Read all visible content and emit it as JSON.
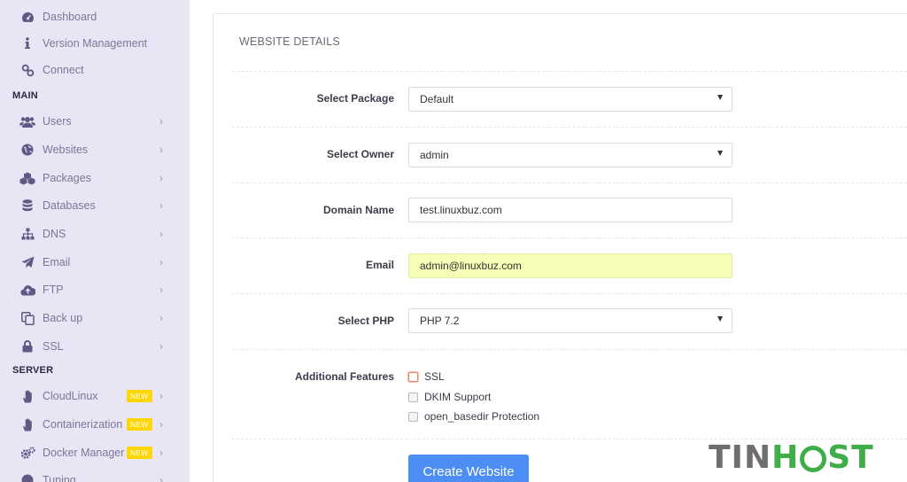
{
  "sidebar": {
    "top_items": [
      {
        "label": "Dashboard",
        "icon": "dashboard-icon"
      },
      {
        "label": "Version Management",
        "icon": "info-icon"
      },
      {
        "label": "Connect",
        "icon": "link-icon"
      }
    ],
    "main_label": "MAIN",
    "main_items": [
      {
        "label": "Users",
        "icon": "users-icon",
        "chevron": "›"
      },
      {
        "label": "Websites",
        "icon": "globe-icon",
        "chevron": "›"
      },
      {
        "label": "Packages",
        "icon": "packages-icon",
        "chevron": "›"
      },
      {
        "label": "Databases",
        "icon": "database-icon",
        "chevron": "›"
      },
      {
        "label": "DNS",
        "icon": "sitemap-icon",
        "chevron": "›"
      },
      {
        "label": "Email",
        "icon": "send-icon",
        "chevron": "›"
      },
      {
        "label": "FTP",
        "icon": "cloud-upload-icon",
        "chevron": "›"
      },
      {
        "label": "Back up",
        "icon": "copy-icon",
        "chevron": "›"
      },
      {
        "label": "SSL",
        "icon": "lock-icon",
        "chevron": "›"
      }
    ],
    "server_label": "SERVER",
    "server_items": [
      {
        "label": "CloudLinux",
        "icon": "hand-icon",
        "badge": "NEW",
        "chevron": "›"
      },
      {
        "label": "Containerization",
        "icon": "hand-icon",
        "badge": "NEW",
        "chevron": "›"
      },
      {
        "label": "Docker Manager",
        "icon": "cogs-icon",
        "badge": "NEW",
        "chevron": "›"
      },
      {
        "label": "Tuning",
        "icon": "tuning-icon",
        "chevron": "›"
      }
    ]
  },
  "form": {
    "title": "WEBSITE DETAILS",
    "package": {
      "label": "Select Package",
      "value": "Default"
    },
    "owner": {
      "label": "Select Owner",
      "value": "admin"
    },
    "domain": {
      "label": "Domain Name",
      "value": "test.linuxbuz.com"
    },
    "email": {
      "label": "Email",
      "value": "admin@linuxbuz.com"
    },
    "php": {
      "label": "Select PHP",
      "value": "PHP 7.2"
    },
    "features": {
      "label": "Additional Features",
      "options": [
        "SSL",
        "DKIM Support",
        "open_basedir Protection"
      ]
    },
    "submit_label": "Create Website"
  },
  "watermark": {
    "part1": "TIN",
    "part2": "H",
    "part3": "ST"
  },
  "colors": {
    "sidebar_bg": "#e8e6f5",
    "button": "#4d8ef5",
    "badge": "#ffd600",
    "email_highlight": "#f6feb6",
    "brand_green": "#3fae49"
  }
}
